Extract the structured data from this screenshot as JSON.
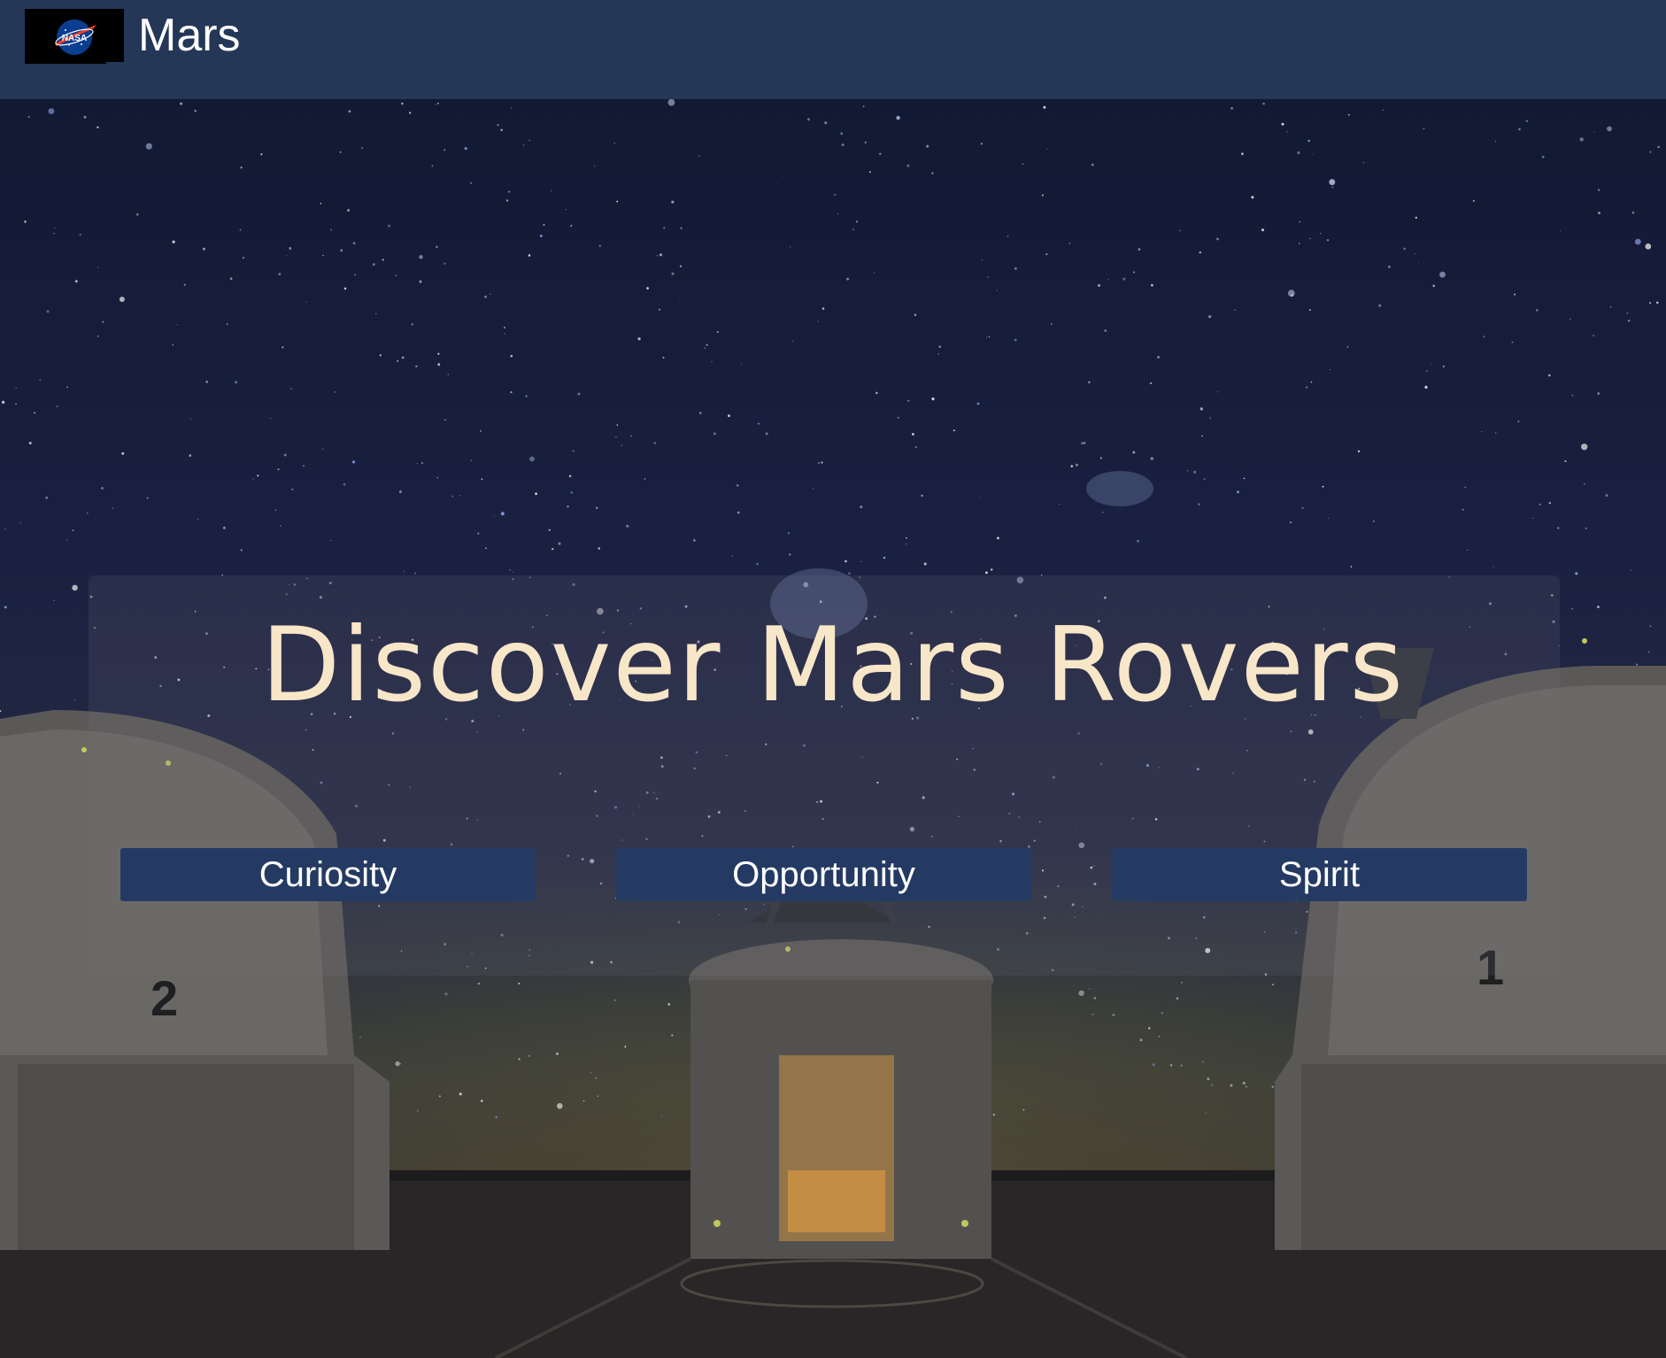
{
  "header": {
    "logo_icon": "nasa-logo-icon",
    "logo_text": "NASA",
    "title": "Mars",
    "background_color": "#243757"
  },
  "hero": {
    "title": "Discover Mars Rovers",
    "title_color": "#f8e6c8"
  },
  "rovers": {
    "buttons": [
      {
        "label": "Curiosity"
      },
      {
        "label": "Opportunity"
      },
      {
        "label": "Spirit"
      }
    ],
    "button_color": "#243a63"
  }
}
